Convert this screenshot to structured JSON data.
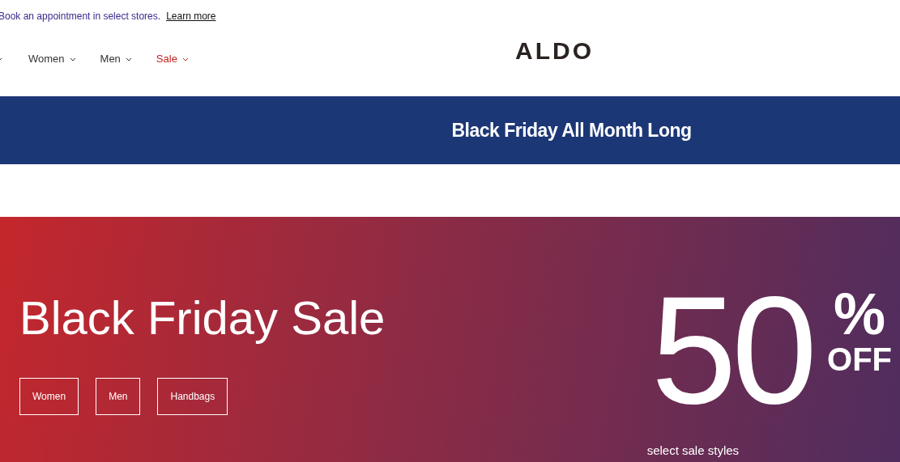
{
  "announcement": {
    "text": "Book an appointment in select stores.",
    "link": "Learn more"
  },
  "nav": [
    {
      "kind": "regular"
    },
    {
      "label": "Women",
      "kind": "regular"
    },
    {
      "label": "Men",
      "kind": "regular"
    },
    {
      "label": "Sale",
      "kind": "sale"
    }
  ],
  "logo": "ALDO",
  "banner": "Black Friday All Month Long",
  "hero": {
    "title": "Black Friday Sale",
    "buttons": [
      "Women",
      "Men",
      "Handbags"
    ],
    "amount": "50",
    "percent": "%",
    "off": "OFF",
    "note": "select sale styles"
  }
}
